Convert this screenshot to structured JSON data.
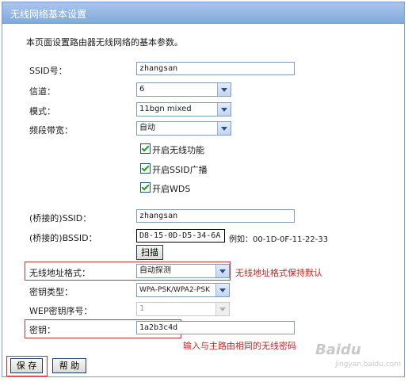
{
  "header": {
    "title": "无线网络基本设置"
  },
  "intro": "本页面设置路由器无线网络的基本参数。",
  "form": {
    "ssid": {
      "label": "SSID号：",
      "value": "zhangsan"
    },
    "channel": {
      "label": "信道：",
      "value": "6"
    },
    "mode": {
      "label": "模式：",
      "value": "11bgn mixed"
    },
    "bandwidth": {
      "label": "频段带宽：",
      "value": "自动"
    },
    "checks": [
      {
        "label": "开启无线功能",
        "checked": true
      },
      {
        "label": "开启SSID广播",
        "checked": true
      },
      {
        "label": "开启WDS",
        "checked": true
      }
    ],
    "bridge_ssid": {
      "label": "(桥接的)SSID：",
      "value": "zhangsan"
    },
    "bridge_bssid": {
      "label": "(桥接的)BSSID：",
      "value": "D8-15-0D-D5-34-6A",
      "example": "例如：00-1D-0F-11-22-33"
    },
    "scan_button": "扫描",
    "addr_format": {
      "label": "无线地址格式：",
      "value": "自动探测",
      "note": "无线地址格式保持默认"
    },
    "key_type": {
      "label": "密钥类型：",
      "value": "WPA-PSK/WPA2-PSK"
    },
    "wep_index": {
      "label": "WEP密钥序号：",
      "value": "1"
    },
    "key": {
      "label": "密钥：",
      "value": "1a2b3c4d",
      "note": "输入与主路由相同的无线密码"
    }
  },
  "footer": {
    "save": "保 存",
    "help": "帮 助"
  },
  "watermark": {
    "logo": "Baidu",
    "sub": "jingyan.baidu.com"
  },
  "colors": {
    "header_bg": "#8fb3e2",
    "accent": "#cc2222",
    "border": "#7a9ec7"
  }
}
